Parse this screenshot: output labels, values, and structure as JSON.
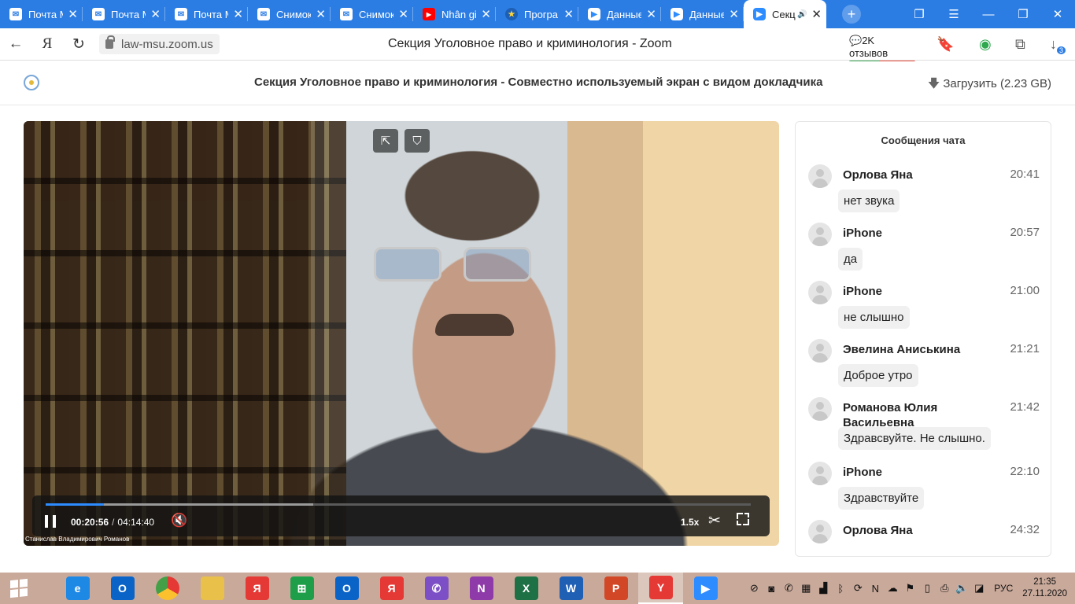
{
  "browser": {
    "tabs": [
      {
        "title": "Почта M",
        "icon": "mail-icon",
        "active": false
      },
      {
        "title": "Почта M",
        "icon": "mail-icon",
        "active": false
      },
      {
        "title": "Почта M",
        "icon": "mail-icon",
        "active": false
      },
      {
        "title": "Снимок",
        "icon": "mail-icon",
        "active": false
      },
      {
        "title": "Снимок",
        "icon": "mail-icon",
        "active": false
      },
      {
        "title": "Nhân gi",
        "icon": "youtube-icon",
        "active": false
      },
      {
        "title": "Програ",
        "icon": "program-icon",
        "active": false
      },
      {
        "title": "Данные",
        "icon": "zoom-icon",
        "active": false
      },
      {
        "title": "Данные",
        "icon": "zoom-icon",
        "active": false
      },
      {
        "title": "Секц",
        "icon": "zoom-icon",
        "active": true
      }
    ],
    "url": "law-msu.zoom.us",
    "page_title": "Секция Уголовное право и криминология - Zoom",
    "reviews": "2K отзывов",
    "downloads_badge": "3",
    "brand_letter": "Я"
  },
  "page": {
    "title": "Секция Уголовное право и криминология - Совместно используемый экран с видом докладчика",
    "download_label": "Загрузить (2.23 GB)"
  },
  "player": {
    "current_time": "00:20:56",
    "total_time": "04:14:40",
    "speed": "1.5x",
    "speaker": "Станислав Владимирович Романов",
    "played_fraction": 0.0822,
    "buffered_fraction": 0.38
  },
  "chat": {
    "title": "Сообщения чата",
    "messages": [
      {
        "name": "Орлова Яна",
        "time": "20:41",
        "text": "нет звука"
      },
      {
        "name": "iPhone",
        "time": "20:57",
        "text": "да"
      },
      {
        "name": "iPhone",
        "time": "21:00",
        "text": "не слышно"
      },
      {
        "name": "Эвелина Аниськина",
        "time": "21:21",
        "text": "Доброе утро"
      },
      {
        "name": "Романова Юлия Васильевна",
        "time": "21:42",
        "text": "Здравсвуйте. Не слышно."
      },
      {
        "name": "iPhone",
        "time": "22:10",
        "text": "Здравствуйте"
      },
      {
        "name": "Орлова Яна",
        "time": "24:32",
        "text": ""
      }
    ]
  },
  "taskbar": {
    "apps": [
      {
        "name": "internet-explorer-icon",
        "label": "e",
        "color": "#1e88e5"
      },
      {
        "name": "outlook-icon",
        "label": "O",
        "color": "#0a64c8"
      },
      {
        "name": "chrome-icon",
        "label": "",
        "color": "#e53935"
      },
      {
        "name": "file-explorer-icon",
        "label": "",
        "color": "#e8c04a"
      },
      {
        "name": "yandex-browser-icon",
        "label": "Я",
        "color": "#e53935"
      },
      {
        "name": "store-icon",
        "label": "⊞",
        "color": "#1f9e4a"
      },
      {
        "name": "outlook-icon",
        "label": "O",
        "color": "#0a64c8"
      },
      {
        "name": "yandex-icon",
        "label": "Я",
        "color": "#e53935"
      },
      {
        "name": "viber-icon",
        "label": "✆",
        "color": "#7d4fc6"
      },
      {
        "name": "onenote-icon",
        "label": "N",
        "color": "#8e3aa8"
      },
      {
        "name": "excel-icon",
        "label": "X",
        "color": "#1e7145"
      },
      {
        "name": "word-icon",
        "label": "W",
        "color": "#1f5fb4"
      },
      {
        "name": "powerpoint-icon",
        "label": "P",
        "color": "#d24726"
      },
      {
        "name": "yandex-browser-icon",
        "label": "Y",
        "color": "#e53935"
      },
      {
        "name": "zoom-icon",
        "label": "▶",
        "color": "#2d8cff"
      }
    ],
    "language": "РУС",
    "time": "21:35",
    "date": "27.11.2020"
  }
}
